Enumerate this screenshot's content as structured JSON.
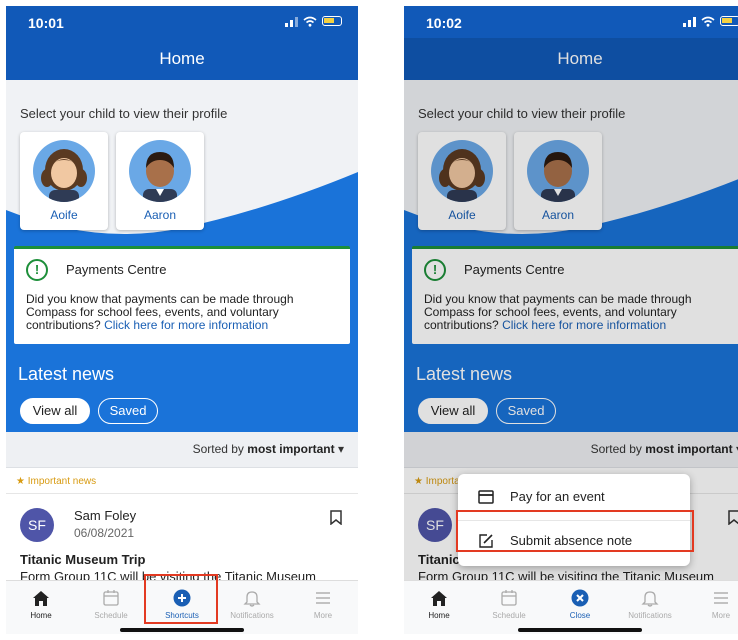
{
  "left_screen": {
    "status_time": "10:01",
    "header_title": "Home",
    "select_prompt": "Select your child to view their profile",
    "children": [
      {
        "name": "Aoife"
      },
      {
        "name": "Aaron"
      }
    ],
    "payments": {
      "title": "Payments Centre",
      "body": "Did you know that payments can be made through Compass for school fees, events, and voluntary contributions?",
      "link": "Click here for more information"
    },
    "latest_news": "Latest news",
    "view_all": "View all",
    "saved": "Saved",
    "sorted_prefix": "Sorted by",
    "sorted_value": "most important",
    "important_label": "Important news",
    "post": {
      "initials": "SF",
      "author": "Sam Foley",
      "date": "06/08/2021",
      "title": "Titanic Museum Trip",
      "body": "Form Group 11C will be visiting the Titanic Museum"
    },
    "tabs": [
      {
        "label": "Home",
        "icon": "home-icon"
      },
      {
        "label": "Schedule",
        "icon": "calendar-icon"
      },
      {
        "label": "Shortcuts",
        "icon": "plus-circle-icon"
      },
      {
        "label": "Notifications",
        "icon": "bell-icon"
      },
      {
        "label": "More",
        "icon": "menu-icon"
      }
    ]
  },
  "right_screen": {
    "status_time": "10:02",
    "header_title": "Home",
    "select_prompt": "Select your child to view their profile",
    "children": [
      {
        "name": "Aoife"
      },
      {
        "name": "Aaron"
      }
    ],
    "payments": {
      "title": "Payments Centre",
      "body": "Did you know that payments can be made through Compass for school fees, events, and voluntary contributions?",
      "link": "Click here for more information"
    },
    "latest_news": "Latest news",
    "view_all": "View all",
    "saved": "Saved",
    "sorted_prefix": "Sorted by",
    "sorted_value": "most important",
    "important_label": "Important news",
    "post": {
      "initials": "SF",
      "title_partial": "Titanic",
      "body": "Form Group 11C will be visiting the Titanic Museum"
    },
    "shortcut_menu": [
      {
        "label": "Pay for an event",
        "icon": "card-icon"
      },
      {
        "label": "Submit absence note",
        "icon": "edit-note-icon"
      }
    ],
    "tabs": [
      {
        "label": "Home",
        "icon": "home-icon"
      },
      {
        "label": "Schedule",
        "icon": "calendar-icon"
      },
      {
        "label": "Close",
        "icon": "close-circle-icon"
      },
      {
        "label": "Notifications",
        "icon": "bell-icon"
      },
      {
        "label": "More",
        "icon": "menu-icon"
      }
    ]
  },
  "colors": {
    "primary_blue": "#1159b8",
    "hero_blue": "#1a73d9",
    "payments_green": "#1d8f3a",
    "highlight_red": "#e33a22",
    "important_gold": "#d89b12"
  }
}
